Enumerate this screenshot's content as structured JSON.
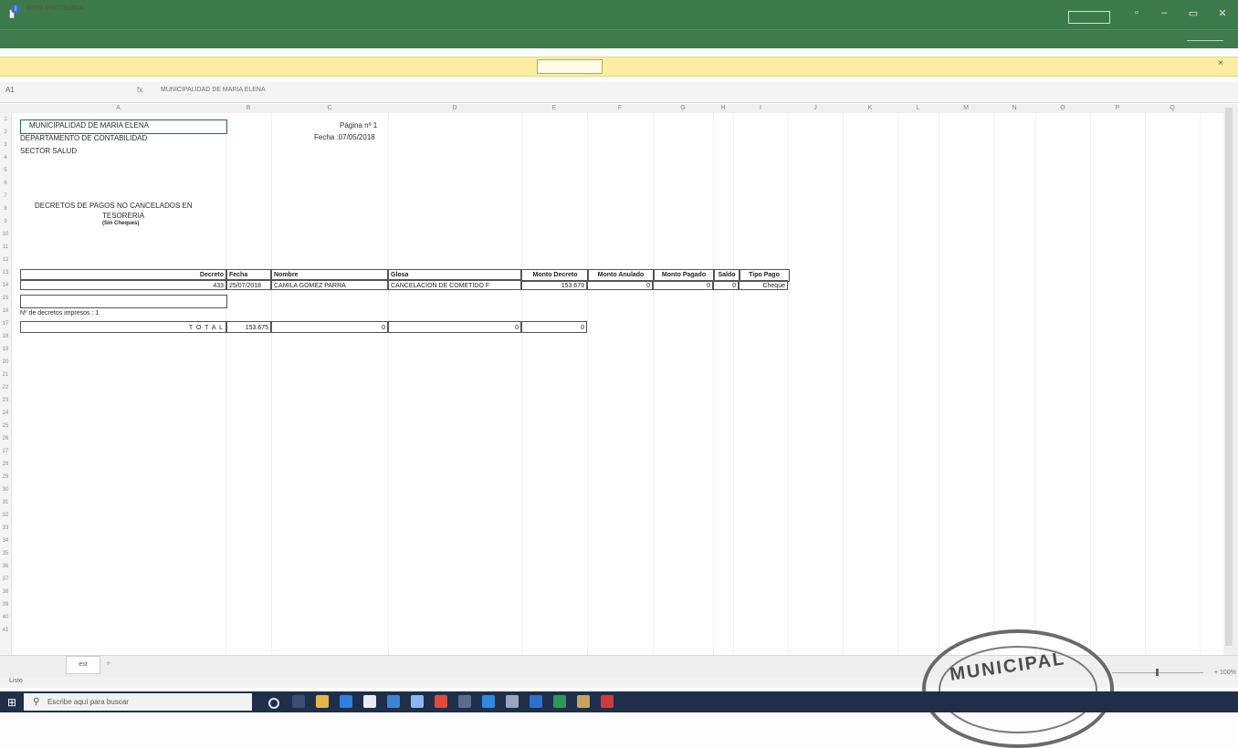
{
  "window": {
    "title": "",
    "file_icon": "excel-save-icon",
    "account_button": ""
  },
  "ribbon": {
    "tabs": [],
    "search": ""
  },
  "protected_view": {
    "label": "VISTA PROTEGIDA",
    "message": "",
    "enable_button": "",
    "close": "×"
  },
  "formula_bar": {
    "name_box": "A1",
    "fx": "fx",
    "value": "MUNICIPALIDAD DE MARIA ELENA"
  },
  "columns": [
    "A",
    "B",
    "C",
    "D",
    "E",
    "F",
    "G",
    "H",
    "I",
    "J",
    "K",
    "L",
    "M",
    "N",
    "O",
    "P",
    "Q"
  ],
  "rows": [
    "1",
    "2",
    "3",
    "4",
    "5",
    "6",
    "7",
    "8",
    "9",
    "10",
    "11",
    "12",
    "13",
    "14",
    "15",
    "16",
    "17",
    "18",
    "19",
    "20",
    "21",
    "22",
    "23",
    "24",
    "25",
    "26",
    "27",
    "28",
    "29",
    "30",
    "31",
    "32",
    "33",
    "34",
    "35",
    "36",
    "37",
    "38",
    "39",
    "40",
    "41"
  ],
  "sheet": {
    "org": "MUNICIPALIDAD DE MARIA ELENA",
    "dept": "DEPARTAMENTO DE CONTABILIDAD",
    "sector": "SECTOR SALUD",
    "page": "Página nº  1",
    "date": "Fecha :07/05/2018",
    "report_title_1": "DECRETOS DE PAGOS NO CANCELADOS EN",
    "report_title_2": "TESORERIA",
    "report_subtitle": "(Sin Cheques)",
    "headers": [
      "Decreto",
      "Fecha",
      "Nombre",
      "Glosa",
      "Monto Decreto",
      "Monto Anulado",
      "Monto Pagado",
      "Saldo",
      "Tipo Pago"
    ],
    "row": {
      "decreto": "433",
      "fecha": "25/07/2018",
      "nombre": "CAMILA GOMEZ PARRA",
      "glosa": "CANCELACION DE COMETIDO F",
      "monto_decreto": "153.679",
      "monto_anulado": "0",
      "monto_pagado": "0",
      "saldo": "0",
      "tipo_pago": "Cheque"
    },
    "count_label": "Nº de decretos impresos : 1",
    "total_label": "T O T A L",
    "total_decreto": "153.675",
    "total_anulado": "0",
    "total_pagado": "0",
    "total_saldo": "0"
  },
  "sheet_tab": "est",
  "sheet_add": "+",
  "status": "Listo",
  "zoom": "+ 100%",
  "taskbar": {
    "search_placeholder": "Escribe aquí para buscar",
    "tray": "",
    "time": "",
    "date": ""
  },
  "stamp": {
    "text": "MUNICIPAL"
  },
  "colors": {
    "excel_green": "#3d7a4b",
    "protected_yellow": "#fbeea2",
    "taskbar": "#1f2f4a"
  }
}
